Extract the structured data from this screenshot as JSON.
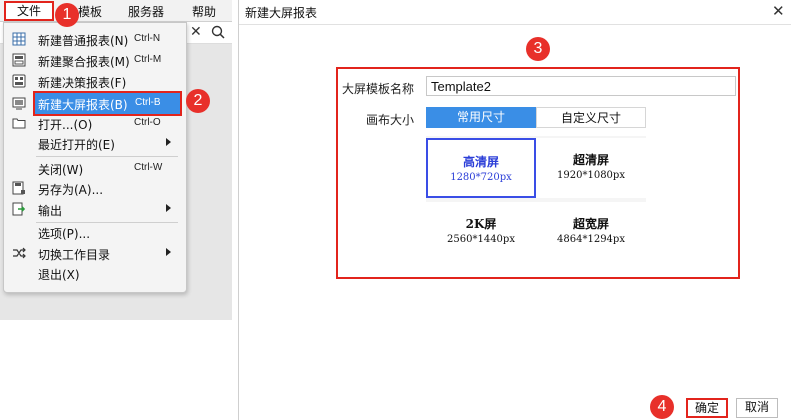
{
  "menubar": {
    "file": "文件",
    "template_partial": "模板",
    "server": "服务器",
    "help": "帮助"
  },
  "file_menu": {
    "items": [
      {
        "label": "新建普通报表(N)",
        "shortcut": "Ctrl-N",
        "icon": "table-icon"
      },
      {
        "label": "新建聚合报表(M)",
        "shortcut": "Ctrl-M",
        "icon": "aggregate-report-icon"
      },
      {
        "label": "新建决策报表(F)",
        "shortcut": "",
        "icon": "dashboard-icon"
      },
      {
        "label": "新建大屏报表(B)",
        "shortcut": "Ctrl-B",
        "icon": "large-screen-icon"
      },
      {
        "label": "打开...(O)",
        "shortcut": "Ctrl-O",
        "icon": "folder-icon"
      },
      {
        "label": "最近打开的(E)",
        "shortcut": "",
        "icon": ""
      },
      {
        "label": "关闭(W)",
        "shortcut": "Ctrl-W",
        "icon": ""
      },
      {
        "label": "另存为(A)...",
        "shortcut": "",
        "icon": "save-as-icon"
      },
      {
        "label": "输出",
        "shortcut": "",
        "icon": "export-icon"
      },
      {
        "label": "选项(P)...",
        "shortcut": "",
        "icon": ""
      },
      {
        "label": "切换工作目录",
        "shortcut": "",
        "icon": "switch-icon"
      },
      {
        "label": "退出(X)",
        "shortcut": "",
        "icon": ""
      }
    ]
  },
  "badges": [
    "1",
    "2",
    "3",
    "4"
  ],
  "dialog": {
    "title": "新建大屏报表",
    "name_label": "大屏模板名称",
    "name_value": "Template2",
    "size_label": "画布大小",
    "tabs": [
      "常用尺寸",
      "自定义尺寸"
    ],
    "cards": [
      {
        "title": "高清屏",
        "dims": "1280*720px"
      },
      {
        "title": "超清屏",
        "dims": "1920*1080px"
      },
      {
        "title": "2K屏",
        "dims": "2560*1440px"
      },
      {
        "title": "超宽屏",
        "dims": "4864*1294px"
      }
    ],
    "ok": "确定",
    "cancel": "取消"
  },
  "colors": {
    "accent": "#3a8ee6",
    "highlight_red": "#e2241c",
    "selected_card": "#3a4ee6"
  }
}
